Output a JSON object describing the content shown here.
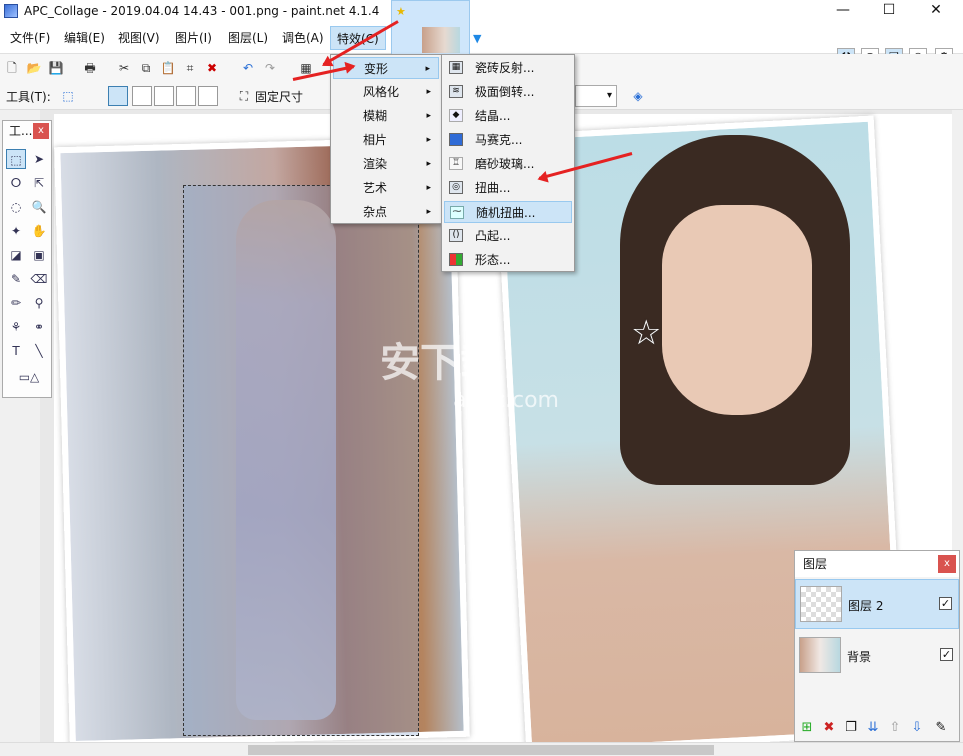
{
  "window": {
    "title": "APC_Collage - 2019.04.04 14.43 - 001.png - paint.net 4.1.4",
    "minimize": "—",
    "maximize": "☐",
    "close": "✕"
  },
  "menubar": {
    "items": [
      "文件(F)",
      "编辑(E)",
      "视图(V)",
      "图片(I)",
      "图层(L)",
      "调色(A)",
      "特效(C)"
    ]
  },
  "toolbar2": {
    "tools_label": "工具(T):",
    "fixed_size": "固定尺寸"
  },
  "tools_panel": {
    "title": "工...",
    "close": "x"
  },
  "effects_menu": {
    "items": [
      {
        "label": "变形",
        "arrow": "▸"
      },
      {
        "label": "风格化",
        "arrow": "▸"
      },
      {
        "label": "模糊",
        "arrow": "▸"
      },
      {
        "label": "相片",
        "arrow": "▸"
      },
      {
        "label": "渲染",
        "arrow": "▸"
      },
      {
        "label": "艺术",
        "arrow": "▸"
      },
      {
        "label": "杂点",
        "arrow": "▸"
      }
    ]
  },
  "distort_menu": {
    "items": [
      "瓷砖反射...",
      "极面倒转...",
      "结晶...",
      "马赛克...",
      "磨砂玻璃...",
      "扭曲...",
      "随机扭曲...",
      "凸起...",
      "形态..."
    ]
  },
  "layers_panel": {
    "title": "图层",
    "close": "x",
    "layers": [
      {
        "name": "图层 2",
        "visible": "✓"
      },
      {
        "name": "背景",
        "visible": "✓"
      }
    ]
  },
  "watermark": {
    "brand": "安下载",
    "url": "anxz.com"
  },
  "colors": {
    "accent": "#cce4f7",
    "arrow": "#e52222"
  }
}
